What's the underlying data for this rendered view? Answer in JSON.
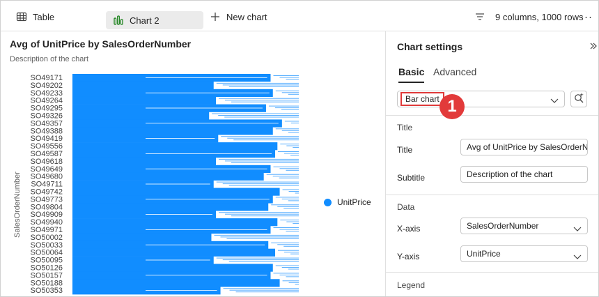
{
  "toolbar": {
    "table_label": "Table",
    "chart_tab_label": "Chart 2",
    "new_chart_label": "New chart",
    "meta_label": "9 columns, 1000 rows",
    "more_label": "···"
  },
  "chart": {
    "title": "Avg of UnitPrice by SalesOrderNumber",
    "subtitle": "Description of the chart",
    "y_axis_title": "SalesOrderNumber",
    "legend_label": "UnitPrice",
    "bar_color": "#118dff"
  },
  "chart_data": {
    "type": "bar",
    "orientation": "horizontal",
    "title": "Avg of UnitPrice by SalesOrderNumber",
    "subtitle": "Description of the chart",
    "ylabel": "SalesOrderNumber",
    "xlabel": "",
    "legend": "right",
    "categories": [
      "SO49171",
      "SO49202",
      "SO49233",
      "SO49264",
      "SO49295",
      "SO49326",
      "SO49357",
      "SO49388",
      "SO49419",
      "SO49556",
      "SO49587",
      "SO49618",
      "SO49649",
      "SO49680",
      "SO49711",
      "SO49742",
      "SO49773",
      "SO49804",
      "SO49909",
      "SO49940",
      "SO49971",
      "SO50002",
      "SO50033",
      "SO50064",
      "SO50095",
      "SO50126",
      "SO50157",
      "SO50188",
      "SO50353"
    ],
    "series": [
      {
        "name": "UnitPrice",
        "values": [
          0.87,
          0.62,
          0.88,
          0.63,
          0.85,
          0.6,
          0.92,
          0.88,
          0.64,
          0.9,
          0.89,
          0.63,
          0.87,
          0.84,
          0.62,
          0.91,
          0.88,
          0.86,
          0.63,
          0.9,
          0.87,
          0.61,
          0.86,
          0.89,
          0.62,
          0.88,
          0.87,
          0.91,
          0.65
        ]
      }
    ]
  },
  "settings": {
    "title": "Chart settings",
    "tab_basic": "Basic",
    "tab_advanced": "Advanced",
    "chart_type_value": "Bar chart",
    "callout_number": "1",
    "section_title": "Title",
    "title_label": "Title",
    "title_value": "Avg of UnitPrice by SalesOrderN",
    "subtitle_label": "Subtitle",
    "subtitle_value": "Description of the chart",
    "section_data": "Data",
    "xaxis_label": "X-axis",
    "xaxis_value": "SalesOrderNumber",
    "yaxis_label": "Y-axis",
    "yaxis_value": "UnitPrice",
    "section_legend": "Legend"
  }
}
